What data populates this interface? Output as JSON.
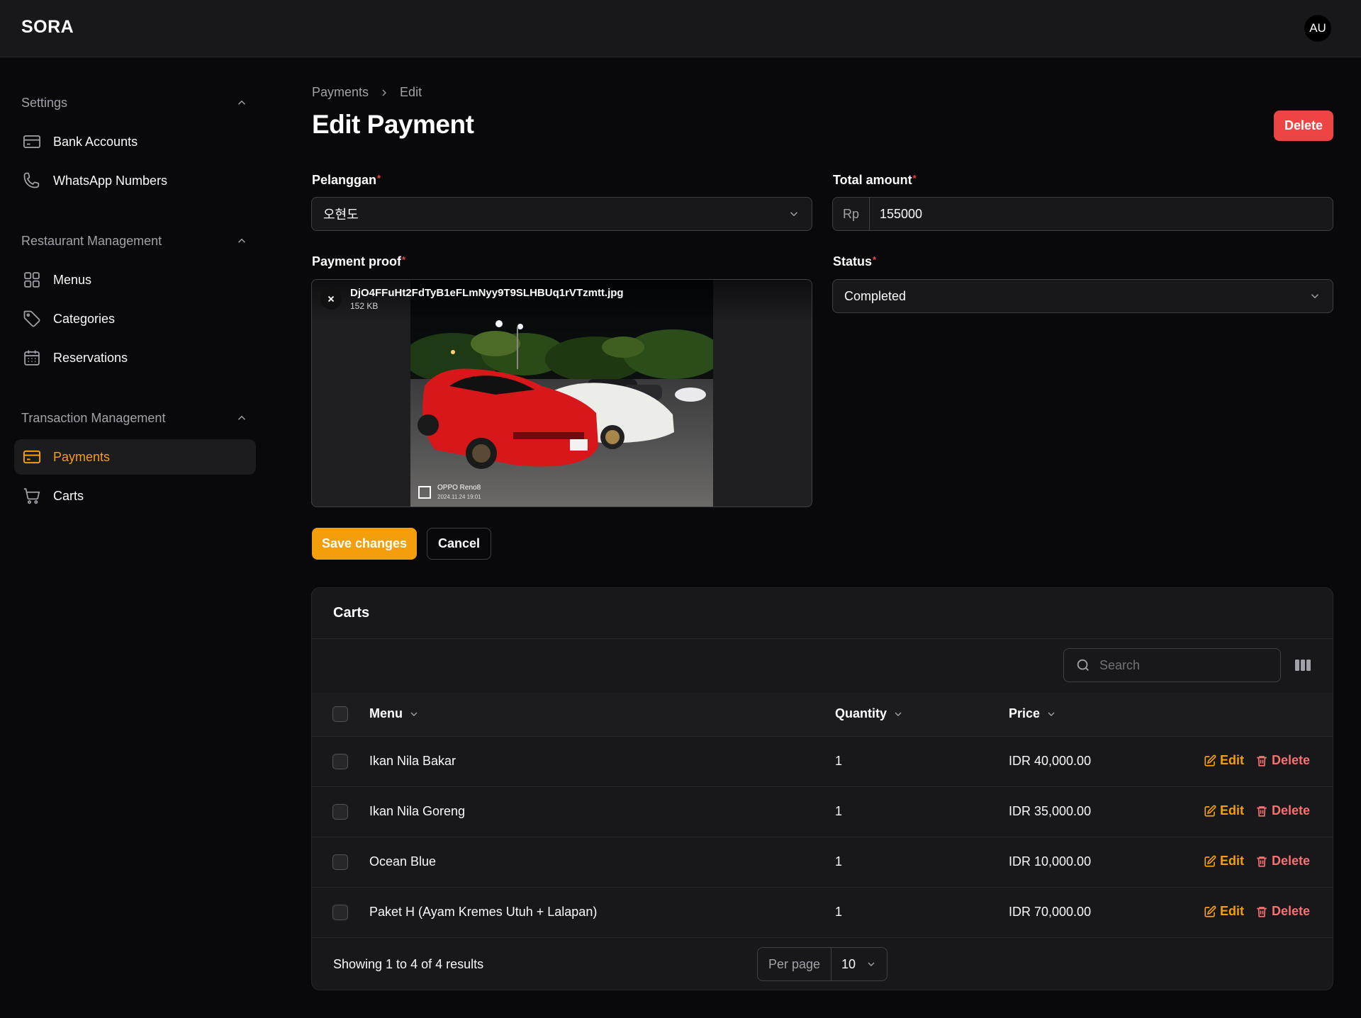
{
  "app": {
    "brand": "SORA",
    "avatar_initials": "AU",
    "accent": "#f59e0b",
    "danger": "#ef4444"
  },
  "sidebar": {
    "groups": [
      {
        "label": "Settings",
        "items": [
          {
            "label": "Bank Accounts",
            "icon": "credit-card-icon"
          },
          {
            "label": "WhatsApp Numbers",
            "icon": "phone-icon"
          }
        ]
      },
      {
        "label": "Restaurant Management",
        "items": [
          {
            "label": "Menus",
            "icon": "grid-icon"
          },
          {
            "label": "Categories",
            "icon": "tag-icon"
          },
          {
            "label": "Reservations",
            "icon": "calendar-icon"
          }
        ]
      },
      {
        "label": "Transaction Management",
        "items": [
          {
            "label": "Payments",
            "icon": "credit-card-icon",
            "active": true
          },
          {
            "label": "Carts",
            "icon": "shopping-cart-icon"
          }
        ]
      }
    ]
  },
  "breadcrumb": {
    "parent": "Payments",
    "current": "Edit"
  },
  "page": {
    "title": "Edit Payment",
    "delete_label": "Delete"
  },
  "form": {
    "customer": {
      "label": "Pelanggan",
      "value": "오현도"
    },
    "total_amount": {
      "label": "Total amount",
      "prefix": "Rp",
      "value": "155000"
    },
    "payment_proof": {
      "label": "Payment proof",
      "file_name": "DjO4FFuHt2FdTyB1eFLmNyy9T9SLHBUq1rVTzmtt.jpg",
      "file_size": "152 KB",
      "image_caption_line1": "OPPO Reno8",
      "image_caption_line2": "2024.11.24 19:01"
    },
    "status": {
      "label": "Status",
      "value": "Completed"
    },
    "save_label": "Save changes",
    "cancel_label": "Cancel"
  },
  "carts": {
    "title": "Carts",
    "search_placeholder": "Search",
    "columns": {
      "menu": "Menu",
      "quantity": "Quantity",
      "price": "Price"
    },
    "rows": [
      {
        "menu": "Ikan Nila Bakar",
        "quantity": "1",
        "price": "IDR 40,000.00"
      },
      {
        "menu": "Ikan Nila Goreng",
        "quantity": "1",
        "price": "IDR 35,000.00"
      },
      {
        "menu": "Ocean Blue",
        "quantity": "1",
        "price": "IDR 10,000.00"
      },
      {
        "menu": "Paket H (Ayam Kremes Utuh + Lalapan)",
        "quantity": "1",
        "price": "IDR 70,000.00"
      }
    ],
    "edit_label": "Edit",
    "delete_label": "Delete",
    "footer": {
      "summary": "Showing 1 to 4 of 4 results",
      "per_page_label": "Per page",
      "per_page_value": "10"
    }
  }
}
